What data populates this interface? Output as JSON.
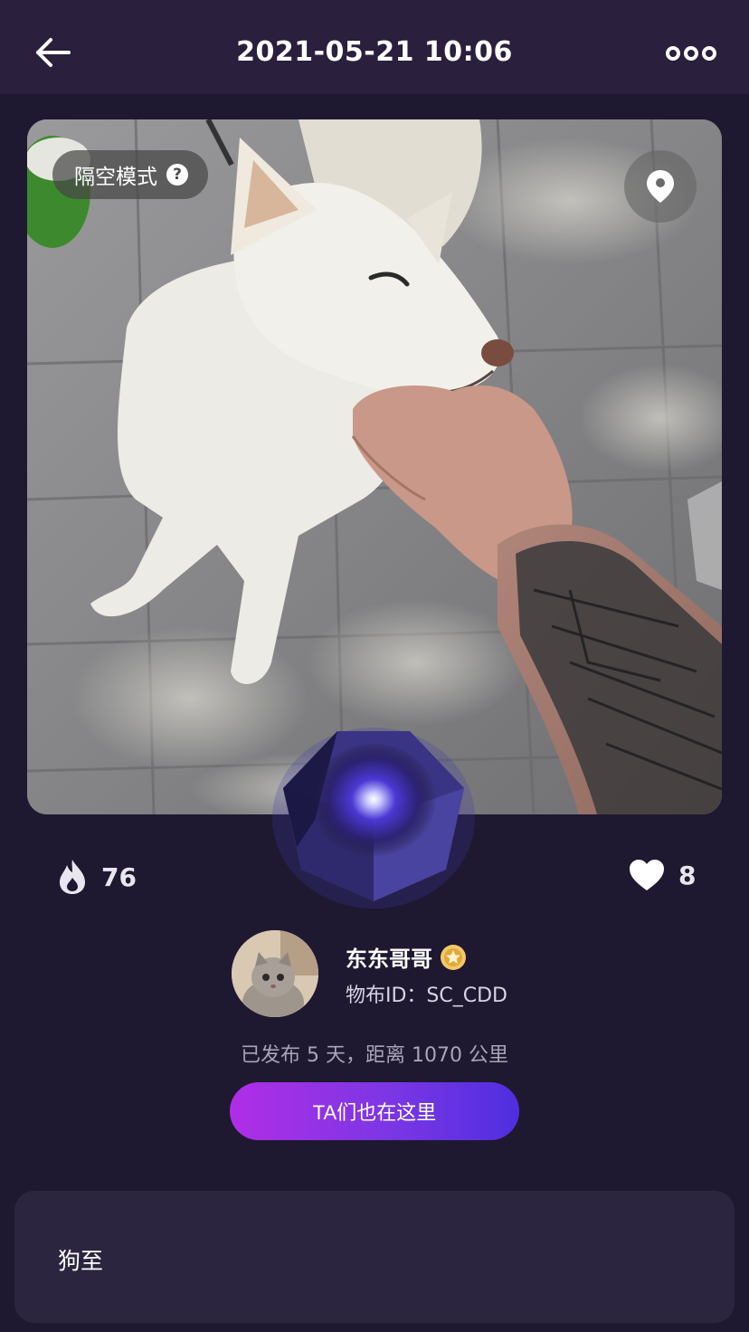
{
  "header": {
    "title": "2021-05-21 10:06",
    "back_icon": "arrow-left-icon",
    "more_icon": "more-dots-icon"
  },
  "photo": {
    "mode_label": "隔空模式",
    "help_glyph": "?",
    "location_icon": "map-pin-icon"
  },
  "gem": {
    "icon": "glowing-gem-icon",
    "glow_color": "#5a4cff"
  },
  "stats": {
    "heat": {
      "icon": "flame-icon",
      "value": "76"
    },
    "likes": {
      "icon": "heart-icon",
      "value": "8"
    }
  },
  "user": {
    "name": "东东哥哥",
    "badge_icon": "gold-star-badge-icon",
    "id_text": "物布ID：SC_CDD"
  },
  "publish_info": "已发布 5 天，距离 1070 公里",
  "cta": {
    "label": "TA们也在这里"
  },
  "caption": {
    "text": "狗至"
  },
  "colors": {
    "background": "#1e1830",
    "header": "#2a1f3d",
    "card": "#2b2540",
    "cta_start": "#b02ee6",
    "cta_end": "#4f2ee0",
    "badge": "#f3c969"
  }
}
